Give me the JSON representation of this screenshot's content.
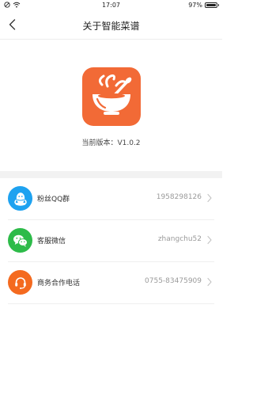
{
  "status_bar": {
    "time": "17:07",
    "battery": "97%",
    "battery_level": 0.97,
    "icons": [
      "do-not-disturb-icon",
      "wifi-icon",
      "battery-icon"
    ]
  },
  "nav": {
    "title": "关于智能菜谱",
    "back_icon": "chevron-left-icon"
  },
  "app": {
    "icon": "soup-bowl-logo-icon",
    "icon_color": "#f26a36",
    "version_text": "当前版本：V1.0.2"
  },
  "contacts": [
    {
      "label": "粉丝QQ群",
      "value": "1958298126",
      "icon": "qq-icon",
      "icon_color": "#1ea2f0"
    },
    {
      "label": "客服微信",
      "value": "zhangchu52",
      "icon": "wechat-icon",
      "icon_color": "#2dbb49"
    },
    {
      "label": "商务合作电话",
      "value": "0755-83475909",
      "icon": "headset-icon",
      "icon_color": "#f46a1f"
    }
  ]
}
